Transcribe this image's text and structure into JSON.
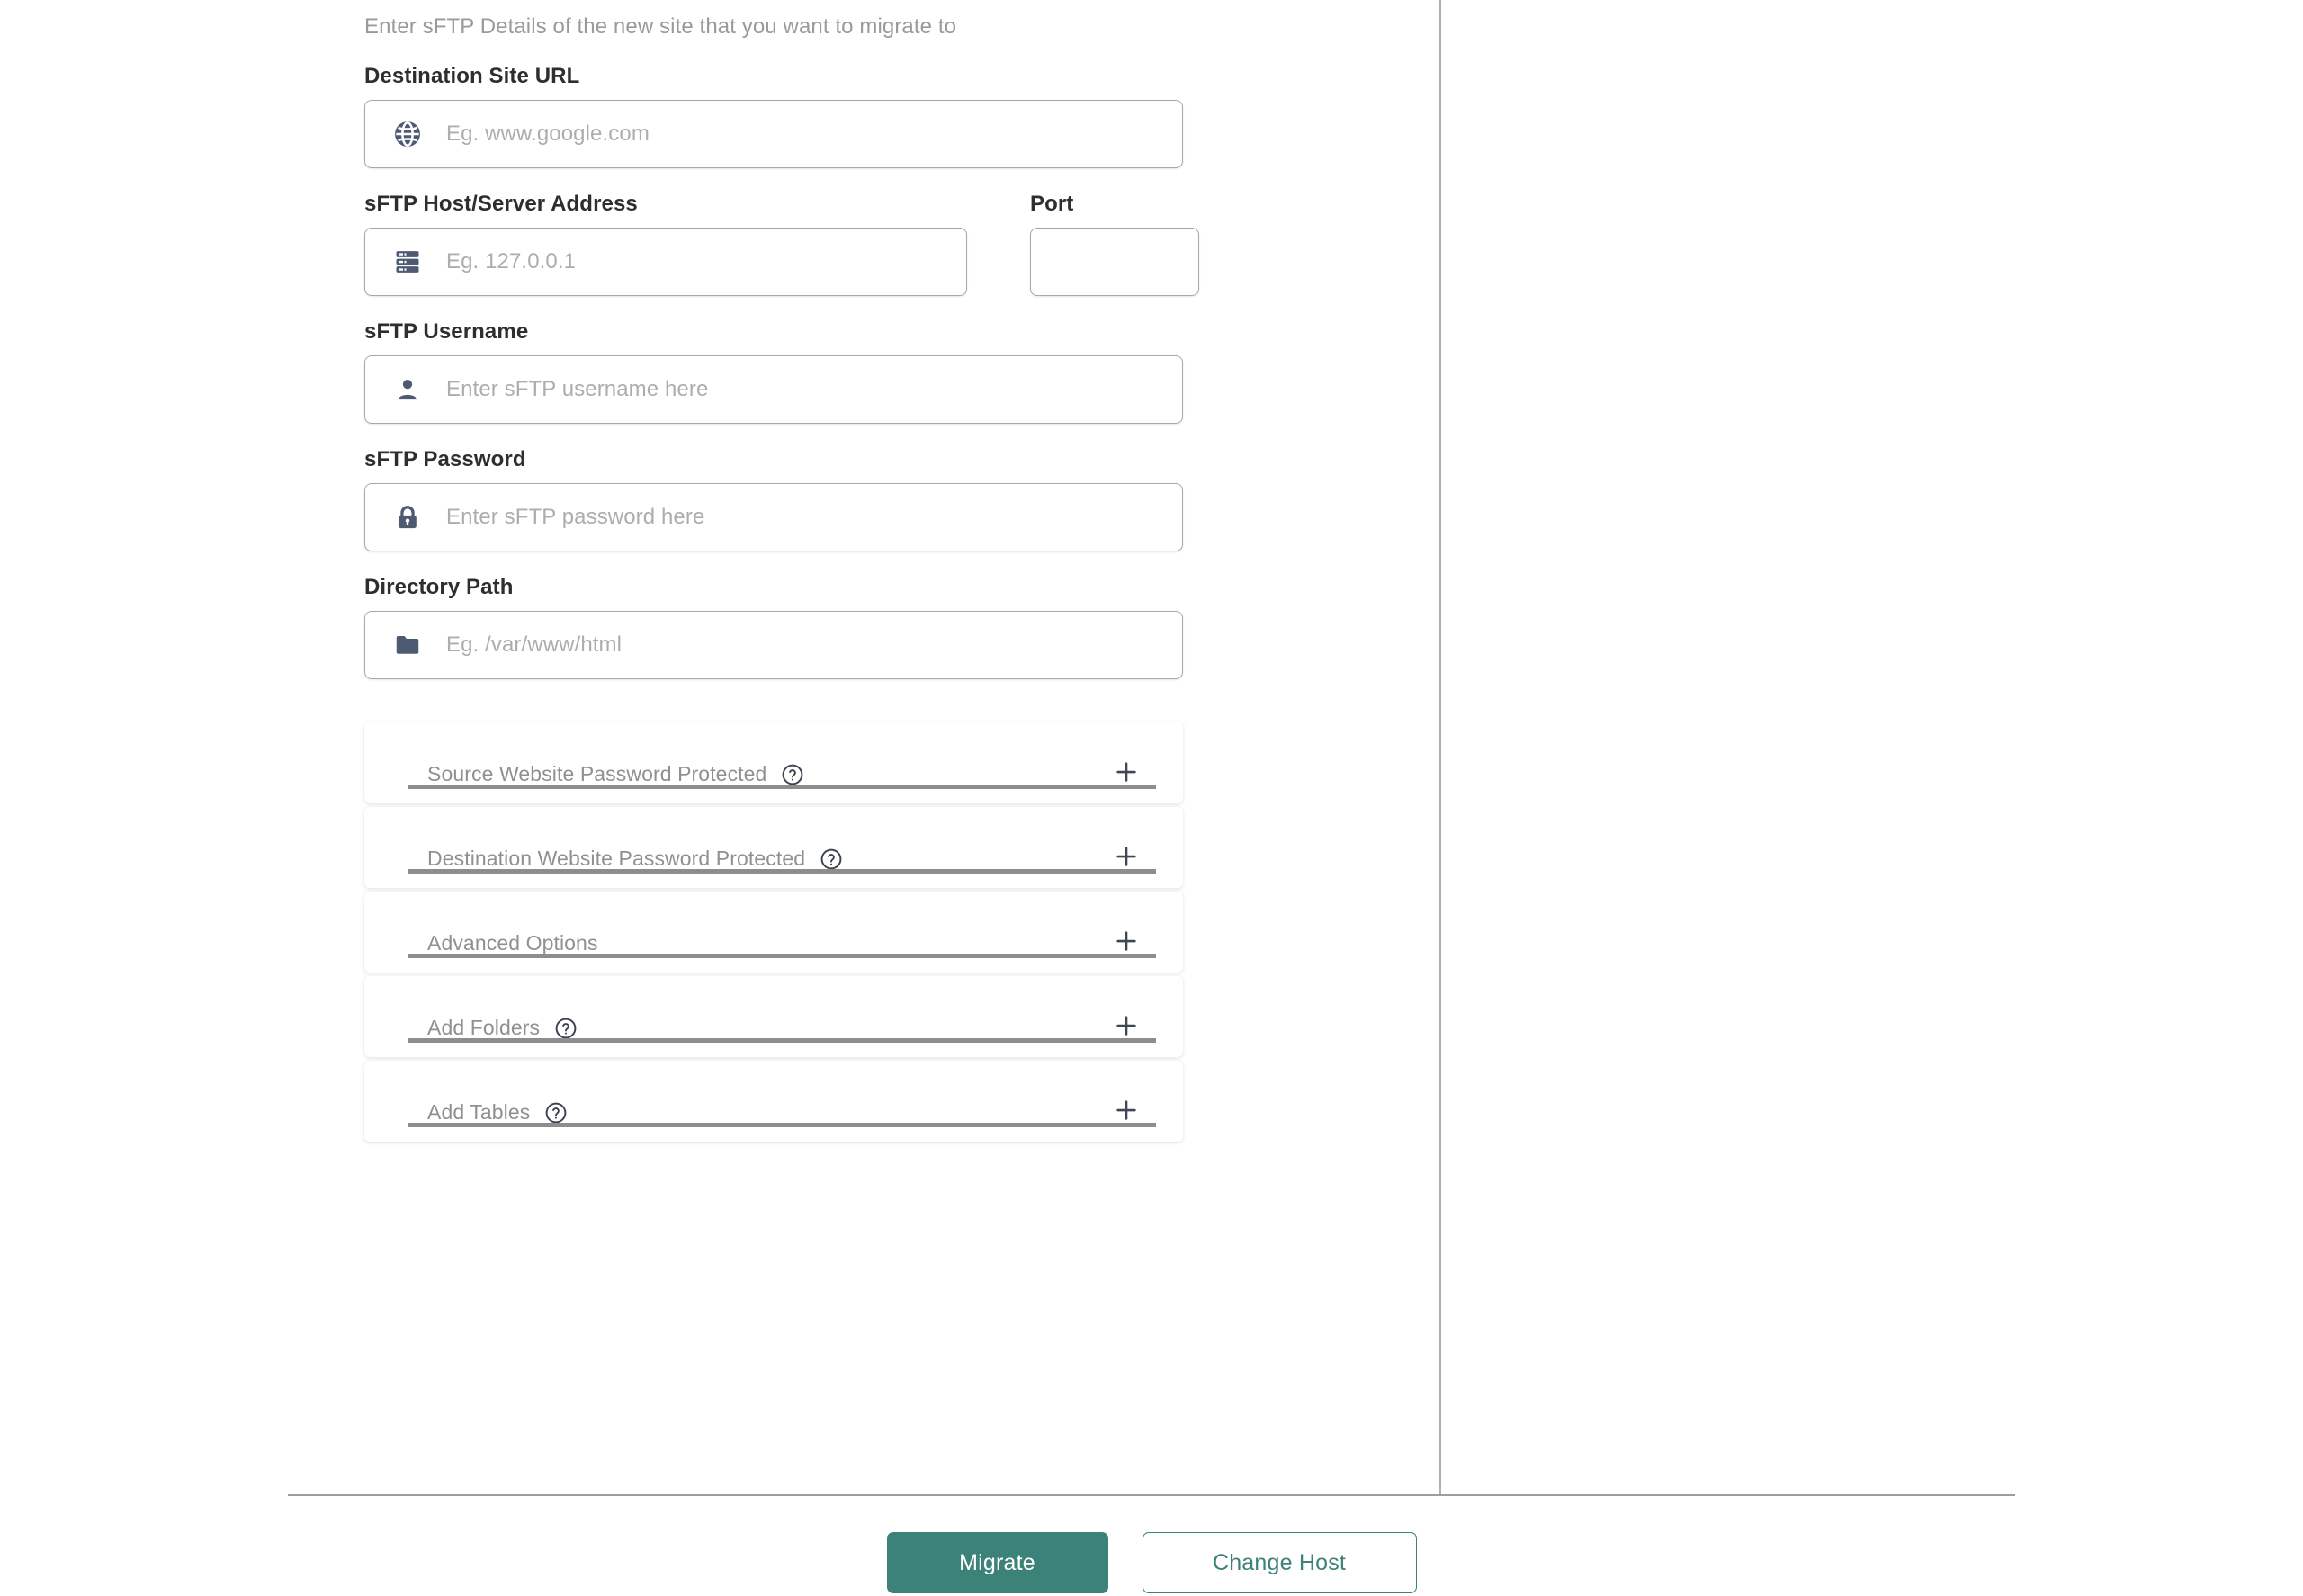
{
  "intro": {
    "text": "Enter sFTP Details of the new site that you want to migrate to"
  },
  "fields": {
    "destination_site_url": {
      "label": "Destination Site URL",
      "placeholder": "Eg. www.google.com",
      "value": "",
      "icon": "globe-icon"
    },
    "sftp_host": {
      "label": "sFTP Host/Server Address",
      "placeholder": "Eg. 127.0.0.1",
      "value": "",
      "icon": "server-icon"
    },
    "port": {
      "label": "Port",
      "placeholder": "",
      "value": ""
    },
    "sftp_username": {
      "label": "sFTP Username",
      "placeholder": "Enter sFTP username here",
      "value": "",
      "icon": "user-icon"
    },
    "sftp_password": {
      "label": "sFTP Password",
      "placeholder": "Enter sFTP password here",
      "value": "",
      "icon": "lock-icon"
    },
    "directory_path": {
      "label": "Directory Path",
      "placeholder": "Eg. /var/www/html",
      "value": "",
      "icon": "folder-icon"
    }
  },
  "accordions": [
    {
      "label": "Source Website Password Protected",
      "has_help": true,
      "expand_symbol": "+"
    },
    {
      "label": "Destination Website Password Protected",
      "has_help": true,
      "expand_symbol": "+"
    },
    {
      "label": "Advanced Options",
      "has_help": false,
      "expand_symbol": "+"
    },
    {
      "label": "Add Folders",
      "has_help": true,
      "expand_symbol": "+"
    },
    {
      "label": "Add Tables",
      "has_help": true,
      "expand_symbol": "+"
    }
  ],
  "actions": {
    "migrate_label": "Migrate",
    "change_host_label": "Change Host"
  },
  "colors": {
    "accent": "#3d8279",
    "label_text": "#2e2e2e",
    "muted_text": "#9a9a9a",
    "placeholder_text": "#adadad",
    "icon_fill": "#4e5a72",
    "border": "#a9a9a9"
  }
}
